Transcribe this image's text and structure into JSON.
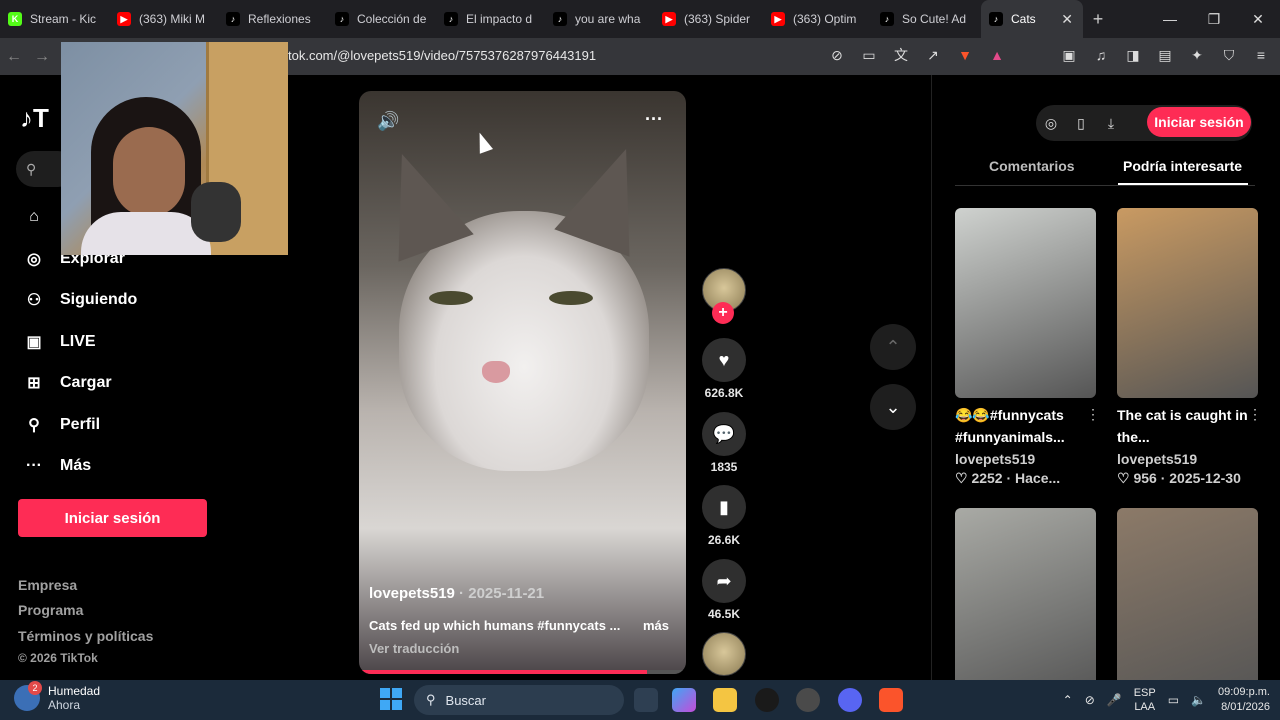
{
  "browser": {
    "tabs": [
      {
        "label": "Stream - Kic",
        "icon": "kick-icon",
        "color": "#53fc18"
      },
      {
        "label": "(363) Miki M",
        "icon": "youtube-icon",
        "color": "#ff0000"
      },
      {
        "label": "Reflexiones",
        "icon": "tiktok-icon",
        "color": "#000000"
      },
      {
        "label": "Colección de",
        "icon": "tiktok-icon",
        "color": "#000000"
      },
      {
        "label": "El impacto d",
        "icon": "tiktok-icon",
        "color": "#000000"
      },
      {
        "label": "you are wha",
        "icon": "tiktok-icon",
        "color": "#000000"
      },
      {
        "label": "(363) Spider",
        "icon": "youtube-icon",
        "color": "#ff0000"
      },
      {
        "label": "(363) Optim",
        "icon": "youtube-icon",
        "color": "#ff0000"
      },
      {
        "label": "So Cute! Ad",
        "icon": "tiktok-icon",
        "color": "#000000"
      },
      {
        "label": "Cats",
        "icon": "tiktok-icon",
        "color": "#000000",
        "active": true
      }
    ],
    "url": "tok.com/@lovepets519/video/7575376287976443191"
  },
  "sidebar": {
    "logo": "T",
    "items": [
      {
        "label": "Explorar",
        "icon": "compass-icon"
      },
      {
        "label": "Siguiendo",
        "icon": "following-icon"
      },
      {
        "label": "LIVE",
        "icon": "live-icon"
      },
      {
        "label": "Cargar",
        "icon": "upload-icon"
      },
      {
        "label": "Perfil",
        "icon": "profile-icon"
      },
      {
        "label": "Más",
        "icon": "more-icon"
      }
    ],
    "login_label": "Iniciar sesión",
    "footer": [
      "Empresa",
      "Programa",
      "Términos y políticas",
      "© 2026 TikTok"
    ]
  },
  "video": {
    "username": "lovepets519",
    "date": " · 2025-11-21",
    "description": "Cats fed up which humans #funnycats ...",
    "more_label": "más",
    "translate_label": "Ver traducción",
    "progress": 0.88
  },
  "actions": {
    "likes": "626.8K",
    "comments": "1835",
    "saves": "26.6K",
    "shares": "46.5K"
  },
  "right_panel": {
    "login_label": "Iniciar sesión",
    "tab_comments": "Comentarios",
    "tab_suggested": "Podría interesarte",
    "cards": [
      {
        "title": "😂😂#funnycats #funnyanimals...",
        "user": "lovepets519",
        "meta": "♡ 2252 · Hace...",
        "thumb_color": "#cfd2cf"
      },
      {
        "title": "The cat is caught in the...",
        "user": "lovepets519",
        "meta": "♡ 956 · 2025-12-30",
        "thumb_color": "#c99a62"
      },
      {
        "title": "",
        "user": "",
        "meta": "",
        "thumb_color": "#a9aaa5"
      },
      {
        "title": "",
        "user": "",
        "meta": "",
        "thumb_color": "#8c7a68"
      }
    ]
  },
  "taskbar": {
    "weather_title": "Humedad",
    "weather_sub": "Ahora",
    "weather_badge": "2",
    "search_label": "Buscar",
    "lang_top": "ESP",
    "lang_bottom": "LAA",
    "time": "09:09:p.m.",
    "date": "8/01/2026"
  }
}
